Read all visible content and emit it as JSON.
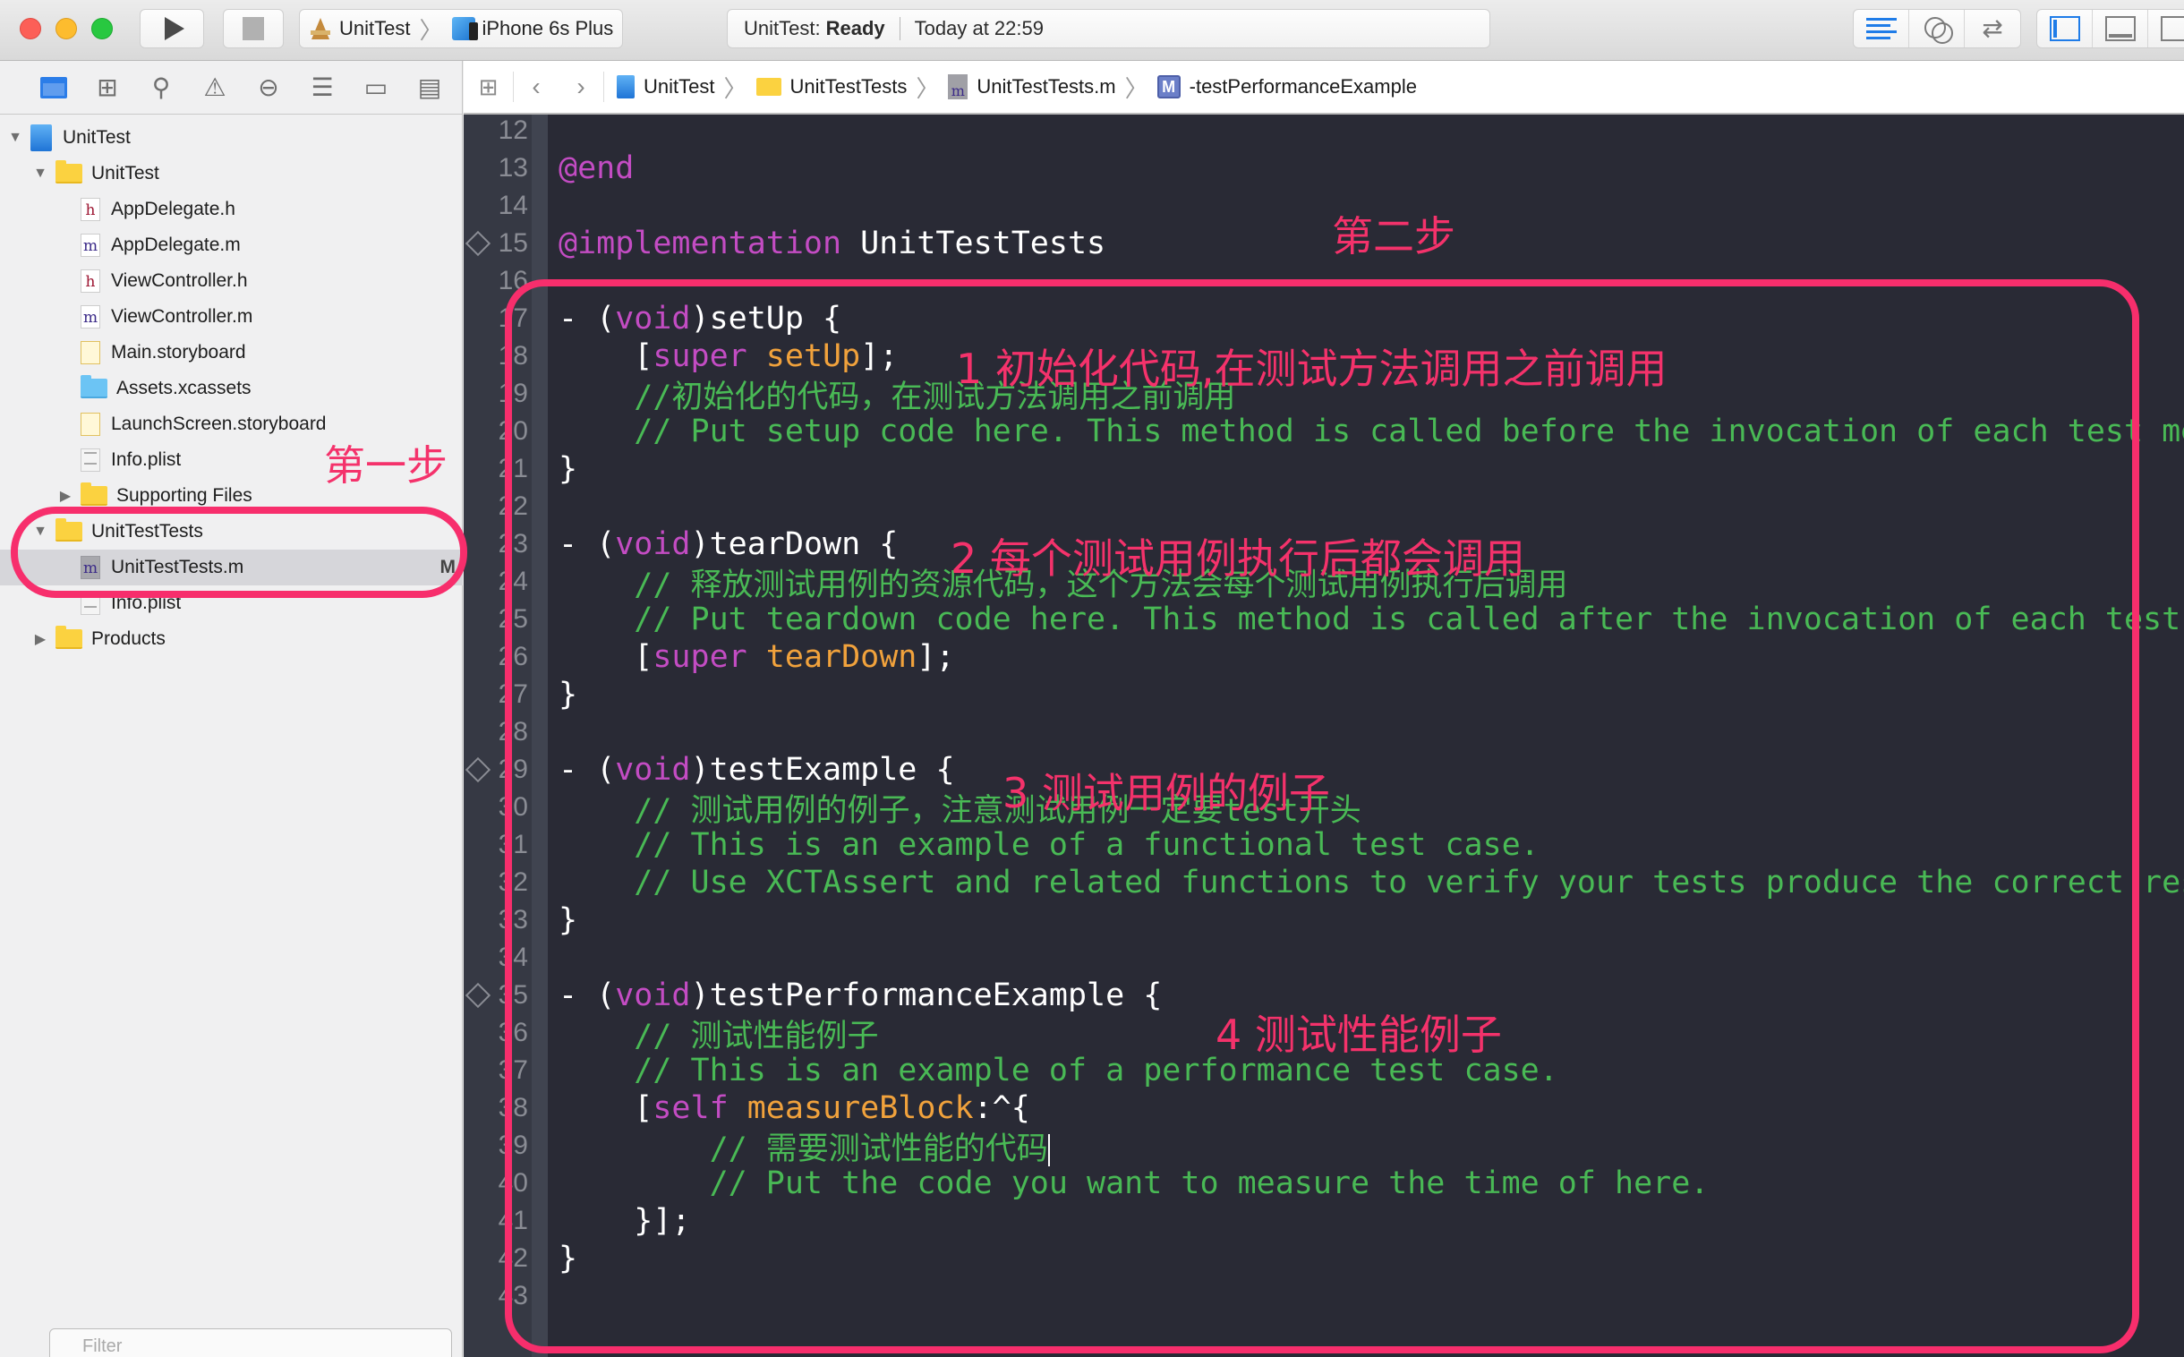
{
  "toolbar": {
    "scheme": {
      "target": "UnitTest",
      "device": "iPhone 6s Plus"
    },
    "activity": {
      "project": "UnitTest:",
      "status": "Ready",
      "time": "Today at 22:59"
    }
  },
  "navigator": {
    "tabs": [
      "project-navigator",
      "symbol-navigator",
      "find-navigator",
      "issue-navigator",
      "test-navigator",
      "debug-navigator",
      "breakpoint-navigator",
      "report-navigator"
    ],
    "tree": [
      {
        "label": "UnitTest",
        "type": "project",
        "level": 0,
        "expanded": true
      },
      {
        "label": "UnitTest",
        "type": "folder",
        "level": 1,
        "expanded": true
      },
      {
        "label": "AppDelegate.h",
        "type": "h",
        "level": 2
      },
      {
        "label": "AppDelegate.m",
        "type": "m",
        "level": 2
      },
      {
        "label": "ViewController.h",
        "type": "h",
        "level": 2
      },
      {
        "label": "ViewController.m",
        "type": "m",
        "level": 2
      },
      {
        "label": "Main.storyboard",
        "type": "storyboard",
        "level": 2
      },
      {
        "label": "Assets.xcassets",
        "type": "assets",
        "level": 2
      },
      {
        "label": "LaunchScreen.storyboard",
        "type": "storyboard",
        "level": 2
      },
      {
        "label": "Info.plist",
        "type": "plist",
        "level": 2
      },
      {
        "label": "Supporting Files",
        "type": "folder",
        "level": 2,
        "expanded": false
      },
      {
        "label": "UnitTestTests",
        "type": "folder",
        "level": 1,
        "expanded": true
      },
      {
        "label": "UnitTestTests.m",
        "type": "m",
        "level": 2,
        "selected": true,
        "badge": "M"
      },
      {
        "label": "Info.plist",
        "type": "plist",
        "level": 2
      },
      {
        "label": "Products",
        "type": "folder",
        "level": 1,
        "expanded": false
      }
    ],
    "filter_placeholder": "Filter"
  },
  "jumpbar": {
    "crumbs": [
      "UnitTest",
      "UnitTestTests",
      "UnitTestTests.m",
      "-testPerformanceExample"
    ],
    "method_badge": "M"
  },
  "editor": {
    "lines": [
      {
        "n": "12",
        "tokens": []
      },
      {
        "n": "13",
        "tokens": [
          [
            "kw",
            "@end"
          ]
        ]
      },
      {
        "n": "14",
        "tokens": []
      },
      {
        "n": "15",
        "diamond": true,
        "tokens": [
          [
            "kw",
            "@implementation"
          ],
          [
            "pl",
            " UnitTestTests"
          ]
        ]
      },
      {
        "n": "16",
        "tokens": []
      },
      {
        "n": "17",
        "tokens": [
          [
            "pl",
            "- ("
          ],
          [
            "kw",
            "void"
          ],
          [
            "pl",
            ")setUp {"
          ]
        ]
      },
      {
        "n": "18",
        "tokens": [
          [
            "pl",
            "    ["
          ],
          [
            "kw",
            "super"
          ],
          [
            "pl",
            " "
          ],
          [
            "msg",
            "setUp"
          ],
          [
            "pl",
            "];"
          ]
        ]
      },
      {
        "n": "19",
        "tokens": [
          [
            "cm",
            "    //初始化的代码，在测试方法调用之前调用"
          ]
        ]
      },
      {
        "n": "20",
        "tokens": [
          [
            "cm",
            "    // Put setup code here. This method is called before the invocation of each test method in the class."
          ]
        ]
      },
      {
        "n": "21",
        "tokens": [
          [
            "pl",
            "}"
          ]
        ]
      },
      {
        "n": "22",
        "tokens": []
      },
      {
        "n": "23",
        "tokens": [
          [
            "pl",
            "- ("
          ],
          [
            "kw",
            "void"
          ],
          [
            "pl",
            ")tearDown {"
          ]
        ]
      },
      {
        "n": "24",
        "tokens": [
          [
            "cm",
            "    // 释放测试用例的资源代码，这个方法会每个测试用例执行后调用"
          ]
        ]
      },
      {
        "n": "25",
        "tokens": [
          [
            "cm",
            "    // Put teardown code here. This method is called after the invocation of each test method in the class."
          ]
        ]
      },
      {
        "n": "26",
        "tokens": [
          [
            "pl",
            "    ["
          ],
          [
            "kw",
            "super"
          ],
          [
            "pl",
            " "
          ],
          [
            "msg",
            "tearDown"
          ],
          [
            "pl",
            "];"
          ]
        ]
      },
      {
        "n": "27",
        "tokens": [
          [
            "pl",
            "}"
          ]
        ]
      },
      {
        "n": "28",
        "tokens": []
      },
      {
        "n": "29",
        "diamond": true,
        "tokens": [
          [
            "pl",
            "- ("
          ],
          [
            "kw",
            "void"
          ],
          [
            "pl",
            ")testExample {"
          ]
        ]
      },
      {
        "n": "30",
        "tokens": [
          [
            "cm",
            "    // 测试用例的例子，注意测试用例一定要test开头"
          ]
        ]
      },
      {
        "n": "31",
        "tokens": [
          [
            "cm",
            "    // This is an example of a functional test case."
          ]
        ]
      },
      {
        "n": "32",
        "tokens": [
          [
            "cm",
            "    // Use XCTAssert and related functions to verify your tests produce the correct results."
          ]
        ]
      },
      {
        "n": "33",
        "tokens": [
          [
            "pl",
            "}"
          ]
        ]
      },
      {
        "n": "34",
        "tokens": []
      },
      {
        "n": "35",
        "diamond": true,
        "tokens": [
          [
            "pl",
            "- ("
          ],
          [
            "kw",
            "void"
          ],
          [
            "pl",
            ")testPerformanceExample {"
          ]
        ]
      },
      {
        "n": "36",
        "tokens": [
          [
            "cm",
            "    // 测试性能例子"
          ]
        ]
      },
      {
        "n": "37",
        "tokens": [
          [
            "cm",
            "    // This is an example of a performance test case."
          ]
        ]
      },
      {
        "n": "38",
        "tokens": [
          [
            "pl",
            "    ["
          ],
          [
            "kw",
            "self"
          ],
          [
            "pl",
            " "
          ],
          [
            "msg",
            "measureBlock"
          ],
          [
            "pl",
            ":^{"
          ]
        ]
      },
      {
        "n": "39",
        "cursor": true,
        "tokens": [
          [
            "cm",
            "        // 需要测试性能的代码"
          ]
        ]
      },
      {
        "n": "40",
        "tokens": [
          [
            "cm",
            "        // Put the code you want to measure the time of here."
          ]
        ]
      },
      {
        "n": "41",
        "tokens": [
          [
            "pl",
            "    }];"
          ]
        ]
      },
      {
        "n": "42",
        "tokens": [
          [
            "pl",
            "}"
          ]
        ]
      },
      {
        "n": "43",
        "tokens": []
      }
    ]
  },
  "annotations": {
    "step1": "第一步",
    "step2": "第二步",
    "note1": "1 初始化代码,在测试方法调用之前调用",
    "note2": "2 每个测试用例执行后都会调用",
    "note3": "3 测试用例的例子",
    "note4": "4 测试性能例子"
  },
  "colors": {
    "annotation": "#f4326b",
    "keyword": "#c34cc3",
    "message": "#f1a23c",
    "comment": "#49b955",
    "editor_bg": "#292a35",
    "accent": "#1f7ce8"
  }
}
